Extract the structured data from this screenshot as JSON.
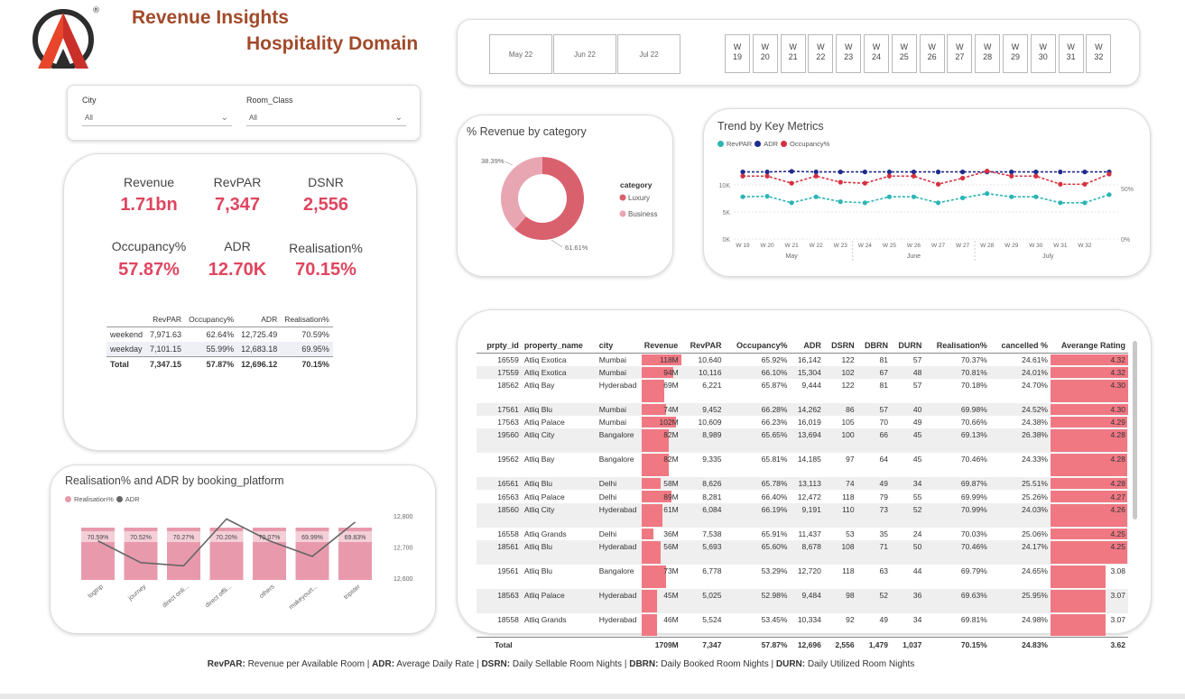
{
  "header": {
    "title_line1": "Revenue Insights",
    "title_line2": "Hospitality Domain",
    "logo_mark": "®"
  },
  "month_slicer": [
    "May 22",
    "Jun 22",
    "Jul 22"
  ],
  "week_slicer": [
    "19",
    "20",
    "21",
    "22",
    "23",
    "24",
    "25",
    "26",
    "27",
    "28",
    "29",
    "30",
    "31",
    "32"
  ],
  "week_prefix": "W",
  "filters": {
    "city": {
      "label": "City",
      "value": "All"
    },
    "room_class": {
      "label": "Room_Class",
      "value": "All"
    }
  },
  "kpis": {
    "revenue": {
      "label": "Revenue",
      "value": "1.71bn"
    },
    "revpar": {
      "label": "RevPAR",
      "value": "7,347"
    },
    "dsnr": {
      "label": "DSNR",
      "value": "2,556"
    },
    "occupancy": {
      "label": "Occupancy%",
      "value": "57.87%"
    },
    "adr": {
      "label": "ADR",
      "value": "12.70K"
    },
    "realisation": {
      "label": "Realisation%",
      "value": "70.15%"
    }
  },
  "daytype_table": {
    "headers": [
      "",
      "RevPAR",
      "Occupancy%",
      "ADR",
      "Realisation%"
    ],
    "rows": [
      [
        "weekend",
        "7,971.63",
        "62.64%",
        "12,725.49",
        "70.59%"
      ],
      [
        "weekday",
        "7,101.15",
        "55.99%",
        "12,683.18",
        "69.95%"
      ]
    ],
    "total": [
      "Total",
      "7,347.15",
      "57.87%",
      "12,696.12",
      "70.15%"
    ]
  },
  "chart_data": [
    {
      "type": "pie",
      "title": "% Revenue by category",
      "legend_title": "category",
      "categories": [
        "Luxury",
        "Business"
      ],
      "values": [
        61.61,
        38.39
      ],
      "value_labels": [
        "61.61%",
        "38.39%"
      ],
      "colors": [
        "#d9606d",
        "#e8a6b2"
      ]
    },
    {
      "type": "line",
      "title": "Trend by Key Metrics",
      "x": [
        "W 19",
        "W 20",
        "W 21",
        "W 22",
        "W 23",
        "W 24",
        "W 25",
        "W 26",
        "W 27",
        "W 27",
        "W 28",
        "W 29",
        "W 30",
        "W 31",
        "W 32"
      ],
      "month_labels": [
        "May",
        "June",
        "July"
      ],
      "y_ticks_left": [
        "0K",
        "5K",
        "10K"
      ],
      "y_ticks_right": [
        "0%",
        "50%"
      ],
      "series": [
        {
          "name": "RevPAR",
          "color": "#2bb5b5",
          "values": [
            7800,
            7900,
            6700,
            7800,
            6900,
            6700,
            7800,
            7800,
            6700,
            7600,
            8400,
            7800,
            7800,
            6700,
            6700,
            8200
          ]
        },
        {
          "name": "ADR",
          "color": "#1f2a8c",
          "values": [
            12400,
            12400,
            12500,
            12400,
            12400,
            12400,
            12400,
            12400,
            12400,
            12400,
            12400,
            12400,
            12400,
            12400,
            12400,
            12400
          ]
        },
        {
          "name": "Occupancy%",
          "color": "#d63040",
          "values": [
            62,
            62,
            55,
            62,
            56,
            55,
            62,
            62,
            54,
            60,
            67,
            62,
            62,
            54,
            54,
            64
          ]
        }
      ]
    },
    {
      "type": "bar",
      "title": "Realisation% and ADR by booking_platform",
      "categories": [
        "logtrip",
        "journey",
        "direct onli...",
        "direct offli...",
        "others",
        "makeyourt...",
        "tripster"
      ],
      "series": [
        {
          "name": "Realisation%",
          "color": "#e89aac",
          "values": [
            70.59,
            70.52,
            70.27,
            70.2,
            70.07,
            69.99,
            69.83
          ],
          "labels": [
            "70.59%",
            "70.52%",
            "70.27%",
            "70.20%",
            "70.07%",
            "69.99%",
            "69.83%"
          ]
        },
        {
          "name": "ADR",
          "color": "#666666",
          "values": [
            12720,
            12650,
            12640,
            12790,
            12720,
            12670,
            12780
          ]
        }
      ],
      "y2_ticks": [
        "12,800",
        "12,700",
        "12,600"
      ],
      "y2lim": [
        12560,
        12820
      ]
    }
  ],
  "property_table": {
    "headers": [
      "prpty_id",
      "property_name",
      "city",
      "Revenue",
      "RevPAR",
      "Occupancy%",
      "ADR",
      "DSRN",
      "DBRN",
      "DURN",
      "Realisation%",
      "cancelled %",
      "Averange Rating"
    ],
    "rows": [
      {
        "id": "16559",
        "name": "Atliq Exotica",
        "city": "Mumbai",
        "rev": "118M",
        "rev_v": 118,
        "revpar": "10,640",
        "occ": "65.92%",
        "adr": "16,142",
        "dsrn": "122",
        "dbrn": "81",
        "durn": "57",
        "real": "70.37%",
        "canc": "24.61%",
        "rating": "4.32",
        "rating_v": 4.32
      },
      {
        "id": "17559",
        "name": "Atliq Exotica",
        "city": "Mumbai",
        "rev": "94M",
        "rev_v": 94,
        "revpar": "10,116",
        "occ": "66.10%",
        "adr": "15,304",
        "dsrn": "102",
        "dbrn": "67",
        "durn": "48",
        "real": "70.81%",
        "canc": "24.01%",
        "rating": "4.32",
        "rating_v": 4.32
      },
      {
        "id": "18562",
        "name": "Atliq Bay",
        "city": "Hyderabad",
        "rev": "69M",
        "rev_v": 69,
        "revpar": "6,221",
        "occ": "65.87%",
        "adr": "9,444",
        "dsrn": "122",
        "dbrn": "81",
        "durn": "57",
        "real": "70.18%",
        "canc": "24.70%",
        "rating": "4.30",
        "rating_v": 4.3
      },
      {
        "id": "17561",
        "name": "Atliq Blu",
        "city": "Mumbai",
        "rev": "74M",
        "rev_v": 74,
        "revpar": "9,452",
        "occ": "66.28%",
        "adr": "14,262",
        "dsrn": "86",
        "dbrn": "57",
        "durn": "40",
        "real": "69.98%",
        "canc": "24.52%",
        "rating": "4.30",
        "rating_v": 4.3
      },
      {
        "id": "17563",
        "name": "Atliq Palace",
        "city": "Mumbai",
        "rev": "102M",
        "rev_v": 102,
        "revpar": "10,609",
        "occ": "66.23%",
        "adr": "16,019",
        "dsrn": "105",
        "dbrn": "70",
        "durn": "49",
        "real": "70.66%",
        "canc": "24.38%",
        "rating": "4.29",
        "rating_v": 4.29
      },
      {
        "id": "19560",
        "name": "Atliq City",
        "city": "Bangalore",
        "rev": "82M",
        "rev_v": 82,
        "revpar": "8,989",
        "occ": "65.65%",
        "adr": "13,694",
        "dsrn": "100",
        "dbrn": "66",
        "durn": "45",
        "real": "69.13%",
        "canc": "26.38%",
        "rating": "4.28",
        "rating_v": 4.28
      },
      {
        "id": "19562",
        "name": "Atliq Bay",
        "city": "Bangalore",
        "rev": "82M",
        "rev_v": 82,
        "revpar": "9,335",
        "occ": "65.81%",
        "adr": "14,185",
        "dsrn": "97",
        "dbrn": "64",
        "durn": "45",
        "real": "70.46%",
        "canc": "24.33%",
        "rating": "4.28",
        "rating_v": 4.28
      },
      {
        "id": "16561",
        "name": "Atliq Blu",
        "city": "Delhi",
        "rev": "58M",
        "rev_v": 58,
        "revpar": "8,626",
        "occ": "65.78%",
        "adr": "13,113",
        "dsrn": "74",
        "dbrn": "49",
        "durn": "34",
        "real": "69.87%",
        "canc": "25.51%",
        "rating": "4.28",
        "rating_v": 4.28
      },
      {
        "id": "16563",
        "name": "Atliq Palace",
        "city": "Delhi",
        "rev": "89M",
        "rev_v": 89,
        "revpar": "8,281",
        "occ": "66.40%",
        "adr": "12,472",
        "dsrn": "118",
        "dbrn": "79",
        "durn": "55",
        "real": "69.99%",
        "canc": "25.26%",
        "rating": "4.27",
        "rating_v": 4.27
      },
      {
        "id": "18560",
        "name": "Atliq City",
        "city": "Hyderabad",
        "rev": "61M",
        "rev_v": 61,
        "revpar": "6,084",
        "occ": "66.19%",
        "adr": "9,191",
        "dsrn": "110",
        "dbrn": "73",
        "durn": "52",
        "real": "70.99%",
        "canc": "24.03%",
        "rating": "4.26",
        "rating_v": 4.26
      },
      {
        "id": "16558",
        "name": "Atliq Grands",
        "city": "Delhi",
        "rev": "36M",
        "rev_v": 36,
        "revpar": "7,538",
        "occ": "65.91%",
        "adr": "11,437",
        "dsrn": "53",
        "dbrn": "35",
        "durn": "24",
        "real": "70.03%",
        "canc": "25.06%",
        "rating": "4.25",
        "rating_v": 4.25
      },
      {
        "id": "18561",
        "name": "Atliq Blu",
        "city": "Hyderabad",
        "rev": "56M",
        "rev_v": 56,
        "revpar": "5,693",
        "occ": "65.60%",
        "adr": "8,678",
        "dsrn": "108",
        "dbrn": "71",
        "durn": "50",
        "real": "70.46%",
        "canc": "24.17%",
        "rating": "4.25",
        "rating_v": 4.25
      },
      {
        "id": "19561",
        "name": "Atliq Blu",
        "city": "Bangalore",
        "rev": "73M",
        "rev_v": 73,
        "revpar": "6,778",
        "occ": "53.29%",
        "adr": "12,720",
        "dsrn": "118",
        "dbrn": "63",
        "durn": "44",
        "real": "69.79%",
        "canc": "24.65%",
        "rating": "3.08",
        "rating_v": 3.08
      },
      {
        "id": "18563",
        "name": "Atliq Palace",
        "city": "Hyderabad",
        "rev": "45M",
        "rev_v": 45,
        "revpar": "5,025",
        "occ": "52.98%",
        "adr": "9,484",
        "dsrn": "98",
        "dbrn": "52",
        "durn": "36",
        "real": "69.63%",
        "canc": "25.95%",
        "rating": "3.07",
        "rating_v": 3.07
      },
      {
        "id": "18558",
        "name": "Atliq Grands",
        "city": "Hyderabad",
        "rev": "46M",
        "rev_v": 46,
        "revpar": "5,524",
        "occ": "53.45%",
        "adr": "10,334",
        "dsrn": "92",
        "dbrn": "49",
        "durn": "34",
        "real": "69.81%",
        "canc": "24.98%",
        "rating": "3.07",
        "rating_v": 3.07
      }
    ],
    "total": {
      "id": "Total",
      "rev": "1709M",
      "revpar": "7,347",
      "occ": "57.87%",
      "adr": "12,696",
      "dsrn": "2,556",
      "dbrn": "1,479",
      "durn": "1,037",
      "real": "70.15%",
      "canc": "24.83%",
      "rating": "3.62"
    },
    "rev_max": 118,
    "rating_max": 4.32
  },
  "footer": [
    {
      "term": "RevPAR:",
      "def": " Revenue per Available Room | "
    },
    {
      "term": "ADR:",
      "def": "  Average Daily Rate | "
    },
    {
      "term": "DSRN:",
      "def": " Daily Sellable Room Nights | "
    },
    {
      "term": "DBRN:",
      "def": " Daily Booked Room Nights | "
    },
    {
      "term": "DURN:",
      "def": " Daily Utilized Room Nights"
    }
  ]
}
